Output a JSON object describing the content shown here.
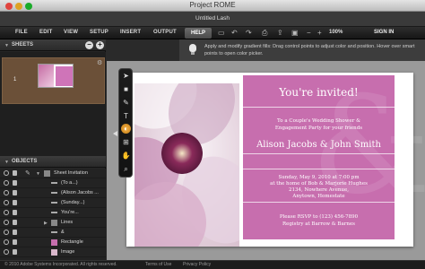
{
  "mac_window": {
    "title": "Project ROME"
  },
  "document": {
    "title": "Untitled Lash"
  },
  "menu": {
    "items": [
      "FILE",
      "EDIT",
      "VIEW",
      "SETUP",
      "INSERT",
      "OUTPUT",
      "HELP"
    ],
    "active": "HELP",
    "zoom": "100%",
    "sign_in": "SIGN IN"
  },
  "toolbar_icons": [
    "save-icon",
    "undo-icon",
    "redo-icon",
    "print-icon",
    "share-icon",
    "preview-icon",
    "zoom-out-icon",
    "zoom-in-icon"
  ],
  "help": {
    "text": "Apply and modify gradient fills: Drag control points to adjust color and position. Hover over smart points to open color picker."
  },
  "sheets": {
    "title": "SHEETS",
    "items": [
      {
        "number": "1"
      }
    ]
  },
  "objects": {
    "title": "OBJECTS",
    "rows": [
      {
        "label": "Sheet Invitation",
        "kind": "folder"
      },
      {
        "label": "(To a...)",
        "kind": "text"
      },
      {
        "label": "(Alison Jacobs ...",
        "kind": "text"
      },
      {
        "label": "(Sunday...)",
        "kind": "text"
      },
      {
        "label": "You're...",
        "kind": "text"
      },
      {
        "label": "Lines",
        "kind": "folder"
      },
      {
        "label": "&",
        "kind": "text"
      },
      {
        "label": "Rectangle",
        "kind": "shape"
      },
      {
        "label": "Image",
        "kind": "image"
      }
    ]
  },
  "invitation": {
    "heading": "You're invited!",
    "line1": "To a Couple's Wedding Shower &",
    "line2": "Engagement Party for your friends",
    "names": "Alison Jacobs  &  John Smith",
    "date": "Sunday, May 9, 2010 at 7:00 pm",
    "host": "at the home of Bob & Marjorie Hughes",
    "address": "2134, Nowhere Avenue,",
    "city": "Anytown, Homestate",
    "rsvp": "Please RSVP to (123) 456-7890",
    "registry": "Registry at Barrow & Barnes",
    "ampersand": "&"
  },
  "footer": {
    "copyright": "© 2010 Adobe Systems Incorporated. All rights reserved.",
    "terms": "Terms of Use",
    "privacy": "Privacy Policy"
  },
  "colors": {
    "accent_pink": "#c76eae",
    "tool_active": "#f0a030"
  }
}
